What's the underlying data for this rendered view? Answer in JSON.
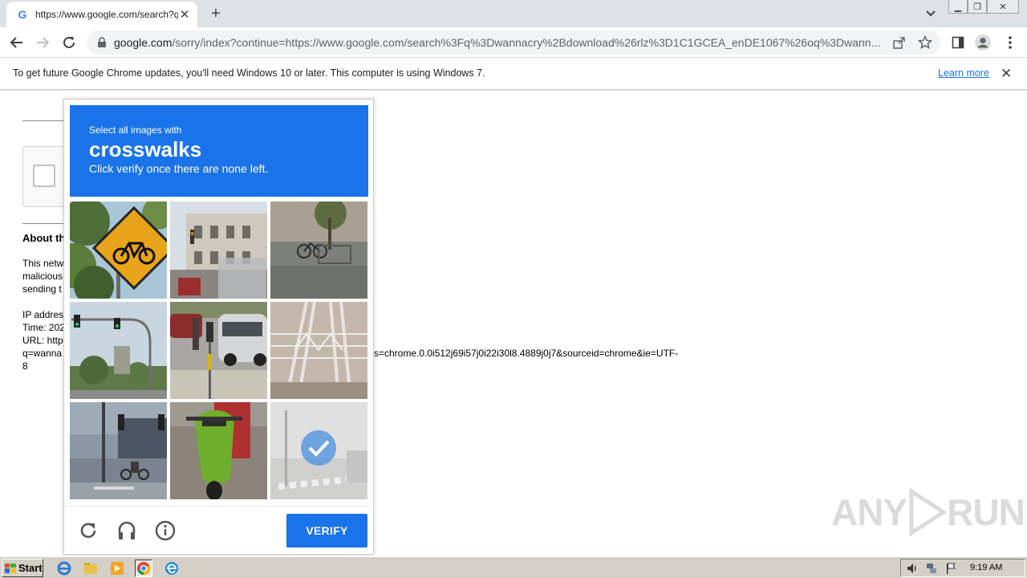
{
  "tab": {
    "title": "https://www.google.com/search?q=",
    "favicon": "G"
  },
  "omnibox": {
    "host": "google.com",
    "path": "/sorry/index?continue=https://www.google.com/search%3Fq%3Dwannacry%2Bdownload%26rlz%3D1C1GCEA_enDE1067%26oq%3Dwann..."
  },
  "infobar": {
    "message": "To get future Google Chrome updates, you'll need Windows 10 or later. This computer is using Windows 7.",
    "link": "Learn more"
  },
  "page": {
    "about_heading": "About th",
    "para_lines": [
      "This netw",
      "malicious",
      "sending t"
    ],
    "ip_line": "IP addres",
    "time_line": "Time: 202",
    "url_line": "URL: http",
    "q_line": "q=wanna",
    "eight": "8",
    "url_tail": "s=chrome.0.0i512j69i57j0i22i30l8.4889j0j7&sourceid=chrome&ie=UTF-"
  },
  "challenge": {
    "instruction_top": "Select all images with",
    "target": "crosswalks",
    "instruction_bottom": "Click verify once there are none left.",
    "verify_label": "VERIFY",
    "selected_tile": 8,
    "header_color": "#1a73e8"
  },
  "watermark": {
    "text_left": "ANY",
    "text_right": "RUN"
  },
  "taskbar": {
    "start_label": "Start",
    "clock": "9:19 AM"
  },
  "colors": {
    "accent": "#1a73e8",
    "taskbar": "#d4d0c8"
  }
}
